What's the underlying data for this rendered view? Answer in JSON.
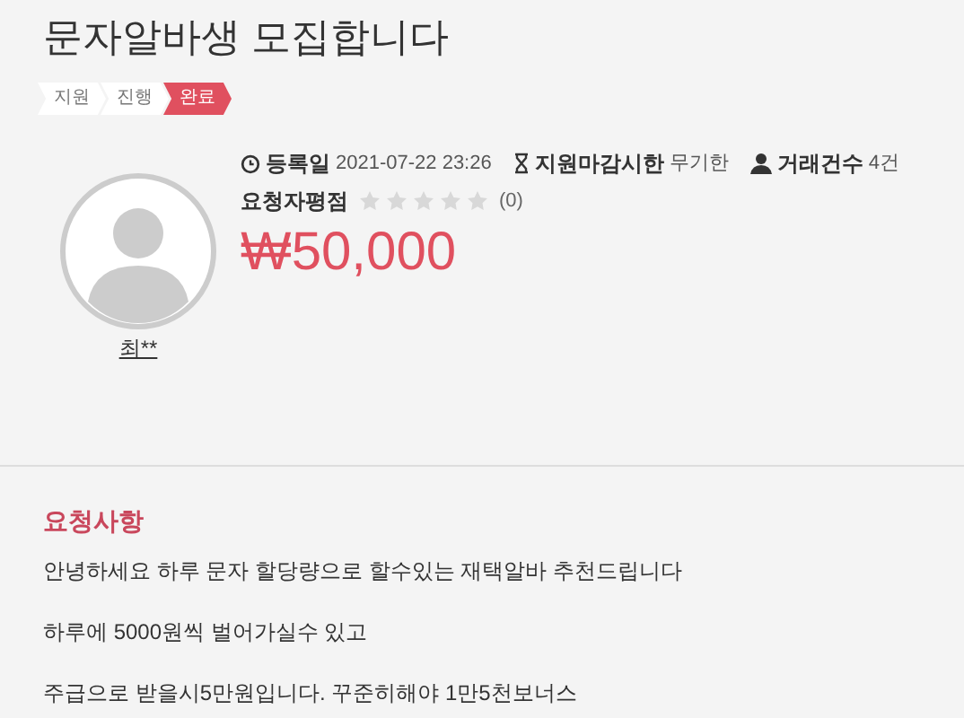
{
  "title": "문자알바생 모집합니다",
  "steps": [
    {
      "label": "지원",
      "selected": false
    },
    {
      "label": "진행",
      "selected": false
    },
    {
      "label": "완료",
      "selected": true
    }
  ],
  "requester": {
    "name": "최**"
  },
  "info": [
    {
      "kind": "clock",
      "label": "등록일",
      "value": "2021-07-22 23:26"
    },
    {
      "kind": "hourglass",
      "label": "지원마감시한",
      "value": "무기한"
    },
    {
      "kind": "person",
      "label": "거래건수",
      "value": "4건"
    }
  ],
  "rating": {
    "label": "요청자평점",
    "stars": 0,
    "count": "(0)"
  },
  "price": "₩50,000",
  "request": {
    "heading": "요청사항",
    "lines": [
      "안녕하세요 하루 문자 할당량으로 할수있는 재택알바 추천드립니다",
      "하루에 5000원씩 벌어가실수 있고",
      "주급으로 받을시5만원입니다. 꾸준히해야 1만5천보너스"
    ]
  }
}
